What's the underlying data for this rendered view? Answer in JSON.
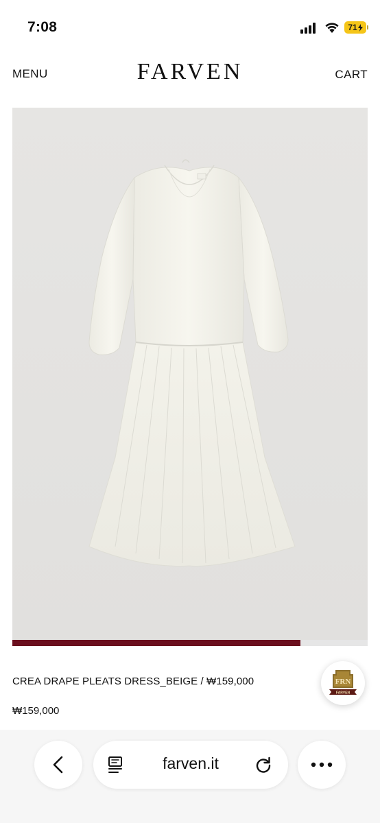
{
  "status_bar": {
    "time": "7:08",
    "battery_level": "71",
    "signal_icon": "cellular-signal-icon",
    "wifi_icon": "wifi-icon",
    "battery_color": "#f5c518"
  },
  "header": {
    "menu_label": "MENU",
    "brand": "FARVEN",
    "cart_label": "CART"
  },
  "product": {
    "image_alt": "product-photo",
    "title": "CREA DRAPE PLEATS DRESS_BEIGE / ₩159,000",
    "price": "₩159,000",
    "gallery_progress": 0.81,
    "accent_color": "#6b0f1e"
  },
  "badge": {
    "icon": "farven-brand-badge-icon",
    "logo_text": "FRN",
    "ribbon_text": "FARVEN"
  },
  "browser": {
    "address": "farven.it",
    "back_icon": "chevron-left-icon",
    "reader_icon": "reader-mode-icon",
    "reload_icon": "reload-icon",
    "more_icon": "more-dots-icon"
  }
}
